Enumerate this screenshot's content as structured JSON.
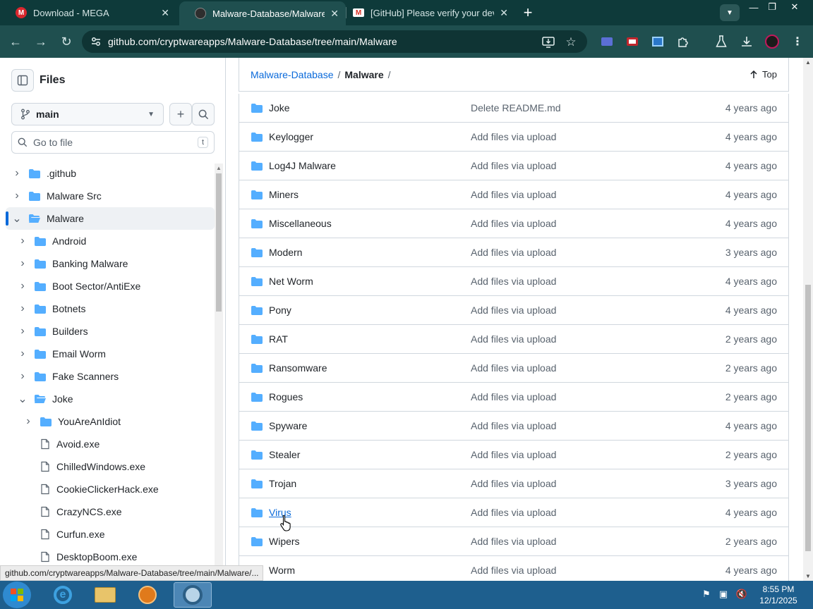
{
  "browser": {
    "tabs": [
      {
        "title": "Download - MEGA",
        "icon": "mega-icon"
      },
      {
        "title": "Malware-Database/Malware at main",
        "icon": "github-icon",
        "active": true
      },
      {
        "title": "[GitHub] Please verify your device",
        "icon": "gmail-icon"
      }
    ],
    "url": "github.com/cryptwareapps/Malware-Database/tree/main/Malware"
  },
  "sidebar": {
    "title": "Files",
    "branch": "main",
    "search_placeholder": "Go to file",
    "search_shortcut": "t",
    "tree": [
      {
        "label": ".github",
        "type": "folder",
        "level": 0,
        "expanded": false
      },
      {
        "label": "Malware Src",
        "type": "folder",
        "level": 0,
        "expanded": false
      },
      {
        "label": "Malware",
        "type": "folder",
        "level": 0,
        "expanded": true,
        "selected": true
      },
      {
        "label": "Android",
        "type": "folder",
        "level": 1,
        "expanded": false
      },
      {
        "label": "Banking Malware",
        "type": "folder",
        "level": 1,
        "expanded": false
      },
      {
        "label": "Boot Sector/AntiExe",
        "type": "folder",
        "level": 1,
        "expanded": false
      },
      {
        "label": "Botnets",
        "type": "folder",
        "level": 1,
        "expanded": false
      },
      {
        "label": "Builders",
        "type": "folder",
        "level": 1,
        "expanded": false
      },
      {
        "label": "Email Worm",
        "type": "folder",
        "level": 1,
        "expanded": false
      },
      {
        "label": "Fake Scanners",
        "type": "folder",
        "level": 1,
        "expanded": false
      },
      {
        "label": "Joke",
        "type": "folder",
        "level": 1,
        "expanded": true
      },
      {
        "label": "YouAreAnIdiot",
        "type": "folder",
        "level": 2,
        "expanded": false
      },
      {
        "label": "Avoid.exe",
        "type": "file",
        "level": 2
      },
      {
        "label": "ChilledWindows.exe",
        "type": "file",
        "level": 2
      },
      {
        "label": "CookieClickerHack.exe",
        "type": "file",
        "level": 2
      },
      {
        "label": "CrazyNCS.exe",
        "type": "file",
        "level": 2
      },
      {
        "label": "Curfun.exe",
        "type": "file",
        "level": 2
      },
      {
        "label": "DesktopBoom.exe",
        "type": "file",
        "level": 2
      }
    ]
  },
  "main": {
    "breadcrumb": {
      "repo": "Malware-Database",
      "separator": "/",
      "current": "Malware",
      "trailing": "/"
    },
    "top_label": "Top",
    "rows": [
      {
        "name": "Joke",
        "message": "Delete README.md",
        "age": "4 years ago"
      },
      {
        "name": "Keylogger",
        "message": "Add files via upload",
        "age": "4 years ago"
      },
      {
        "name": "Log4J Malware",
        "message": "Add files via upload",
        "age": "4 years ago"
      },
      {
        "name": "Miners",
        "message": "Add files via upload",
        "age": "4 years ago"
      },
      {
        "name": "Miscellaneous",
        "message": "Add files via upload",
        "age": "4 years ago"
      },
      {
        "name": "Modern",
        "message": "Add files via upload",
        "age": "3 years ago"
      },
      {
        "name": "Net Worm",
        "message": "Add files via upload",
        "age": "4 years ago"
      },
      {
        "name": "Pony",
        "message": "Add files via upload",
        "age": "4 years ago"
      },
      {
        "name": "RAT",
        "message": "Add files via upload",
        "age": "2 years ago"
      },
      {
        "name": "Ransomware",
        "message": "Add files via upload",
        "age": "2 years ago"
      },
      {
        "name": "Rogues",
        "message": "Add files via upload",
        "age": "2 years ago"
      },
      {
        "name": "Spyware",
        "message": "Add files via upload",
        "age": "4 years ago"
      },
      {
        "name": "Stealer",
        "message": "Add files via upload",
        "age": "2 years ago"
      },
      {
        "name": "Trojan",
        "message": "Add files via upload",
        "age": "3 years ago"
      },
      {
        "name": "Virus",
        "message": "Add files via upload",
        "age": "4 years ago",
        "hover": true
      },
      {
        "name": "Wipers",
        "message": "Add files via upload",
        "age": "2 years ago"
      },
      {
        "name": "Worm",
        "message": "Add files via upload",
        "age": "4 years ago"
      }
    ]
  },
  "status_url": "github.com/cryptwareapps/Malware-Database/tree/main/Malware/...",
  "taskbar": {
    "time": "8:55 PM",
    "date": "12/1/2025"
  },
  "colors": {
    "chrome_dark": "#0e3a3a",
    "chrome_toolbar": "#1f4f4f",
    "folder_blue": "#54aeff",
    "link_blue": "#0969da",
    "taskbar": "#1e5f8e"
  }
}
